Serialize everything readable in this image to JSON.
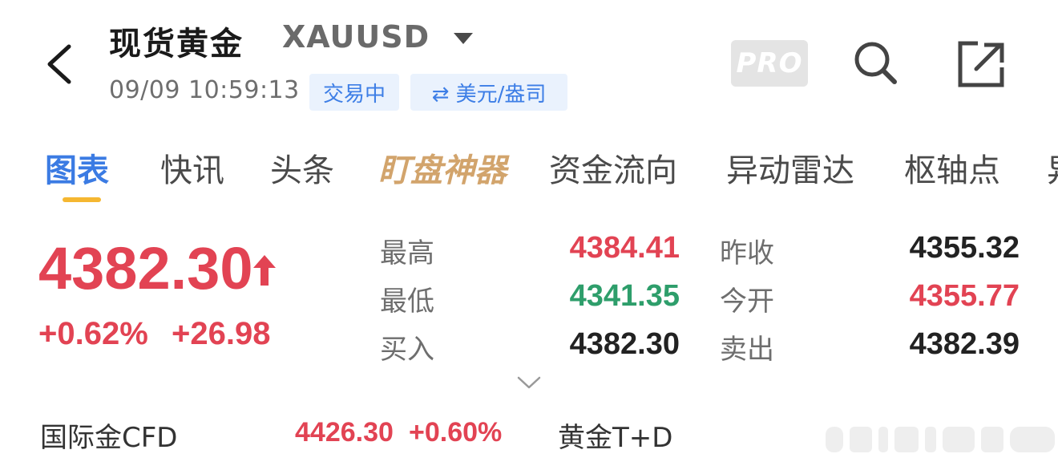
{
  "header": {
    "title": "现货黄金",
    "symbol": "XAUUSD",
    "timestamp": "09/09 10:59:13",
    "status_tag": "交易中",
    "unit_tag": "⇄ 美元/盎司",
    "pro_label": "PRO"
  },
  "tabs": [
    {
      "label": "图表",
      "active": true
    },
    {
      "label": "快讯"
    },
    {
      "label": "头条"
    },
    {
      "label": "盯盘神器"
    },
    {
      "label": "资金流向"
    },
    {
      "label": "异动雷达"
    },
    {
      "label": "枢轴点"
    },
    {
      "label": "异"
    }
  ],
  "quote": {
    "price": "4382.30",
    "change_pct": "+0.62%",
    "change_abs": "+26.98"
  },
  "stats": {
    "high_label": "最高",
    "high_value": "4384.41",
    "low_label": "最低",
    "low_value": "4341.35",
    "bid_label": "买入",
    "bid_value": "4382.30",
    "prev_close_label": "昨收",
    "prev_close_value": "4355.32",
    "open_label": "今开",
    "open_value": "4355.77",
    "ask_label": "卖出",
    "ask_value": "4382.39"
  },
  "tickers": [
    {
      "name": "国际金CFD",
      "price": "4426.30",
      "change": "+0.60%"
    },
    {
      "name": "黄金T+D"
    }
  ],
  "colors": {
    "up": "#e24353",
    "down": "#2e9e6b",
    "neutral": "#222222",
    "accent": "#3b7be3",
    "tab_underline": "#f5b731"
  }
}
